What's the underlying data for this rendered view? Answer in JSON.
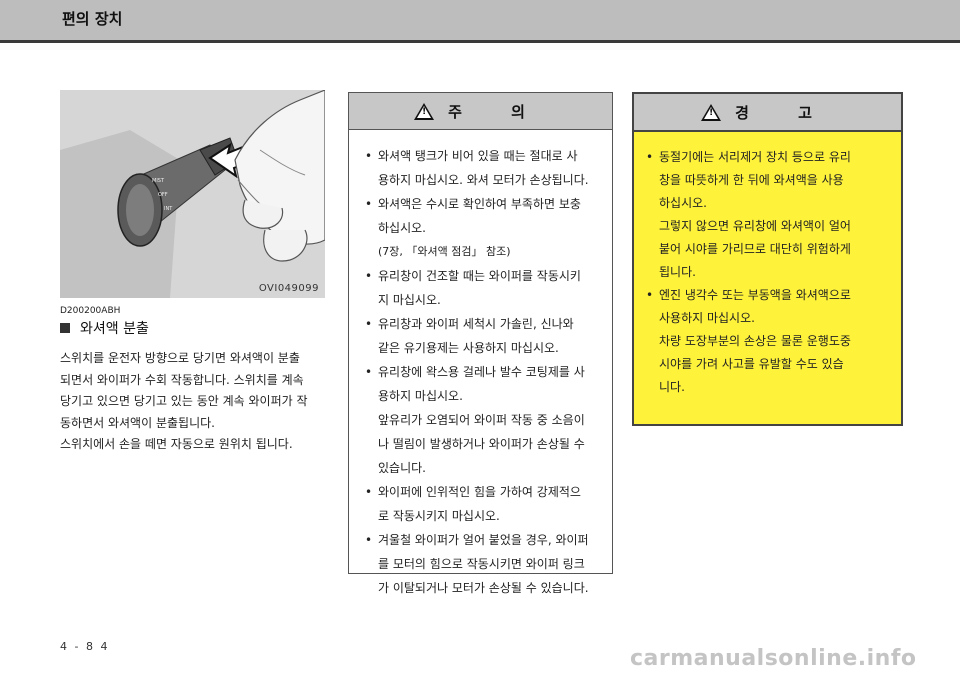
{
  "header": {
    "title": "편의 장치"
  },
  "figure": {
    "code": "OVI049099"
  },
  "section": {
    "doc_id": "D200200ABH",
    "heading": "와셔액 분출",
    "paragraphs": [
      "스위치를 운전자 방향으로 당기면 와셔액이 분출",
      "되면서 와이퍼가 수회 작동합니다. 스위치를 계속",
      "당기고 있으면 당기고 있는 동안 계속 와이퍼가 작",
      "동하면서 와셔액이 분출됩니다.",
      "스위치에서 손을 떼면 자동으로 원위치 됩니다."
    ]
  },
  "caution": {
    "icon": "warning-triangle-icon",
    "title": "주 의",
    "items": [
      {
        "lines": [
          "와셔액 탱크가 비어 있을 때는 절대로 사",
          "용하지 마십시오. 와셔 모터가 손상됩니다."
        ]
      },
      {
        "lines": [
          "와셔액은 수시로 확인하여 부족하면 보충",
          "하십시오.",
          "(7장, 「와셔액 점검」 참조)"
        ]
      },
      {
        "lines": [
          "유리창이 건조할 때는 와이퍼를 작동시키",
          "지 마십시오."
        ]
      },
      {
        "lines": [
          "유리창과 와이퍼 세척시 가솔린, 신나와",
          "같은 유기용제는 사용하지 마십시오."
        ]
      },
      {
        "lines": [
          "유리창에 왁스용 걸레나 발수 코팅제를 사",
          "용하지 마십시오.",
          "앞유리가 오염되어 와이퍼 작동 중 소음이",
          "나 떨림이 발생하거나 와이퍼가 손상될 수",
          "있습니다."
        ]
      },
      {
        "lines": [
          "와이퍼에 인위적인 힘을 가하여 강제적으",
          "로 작동시키지 마십시오."
        ]
      },
      {
        "lines": [
          "겨울철 와이퍼가 얼어 붙었을 경우, 와이퍼",
          "를 모터의 힘으로 작동시키면 와이퍼 링크",
          "가 이탈되거나 모터가 손상될 수 있습니다."
        ]
      }
    ]
  },
  "warning": {
    "icon": "warning-triangle-icon",
    "title": "경 고",
    "bg_color": "#fff23a",
    "items": [
      {
        "lines": [
          "동절기에는 서리제거 장치 등으로 유리",
          "창을 따뜻하게 한 뒤에 와셔액을 사용",
          "하십시오.",
          "그렇지 않으면 유리창에 와셔액이 얼어",
          "붙어 시야를 가리므로 대단히 위험하게",
          "됩니다."
        ]
      },
      {
        "lines": [
          "엔진 냉각수 또는 부동액을 와셔액으로",
          "사용하지 마십시오.",
          "차량 도장부분의 손상은 물론 운행도중",
          "시야를 가려 사고를 유발할 수도 있습",
          "니다."
        ]
      }
    ]
  },
  "footer": {
    "page_number": "4 - 8 4",
    "watermark": "carmanualsonline.info"
  }
}
